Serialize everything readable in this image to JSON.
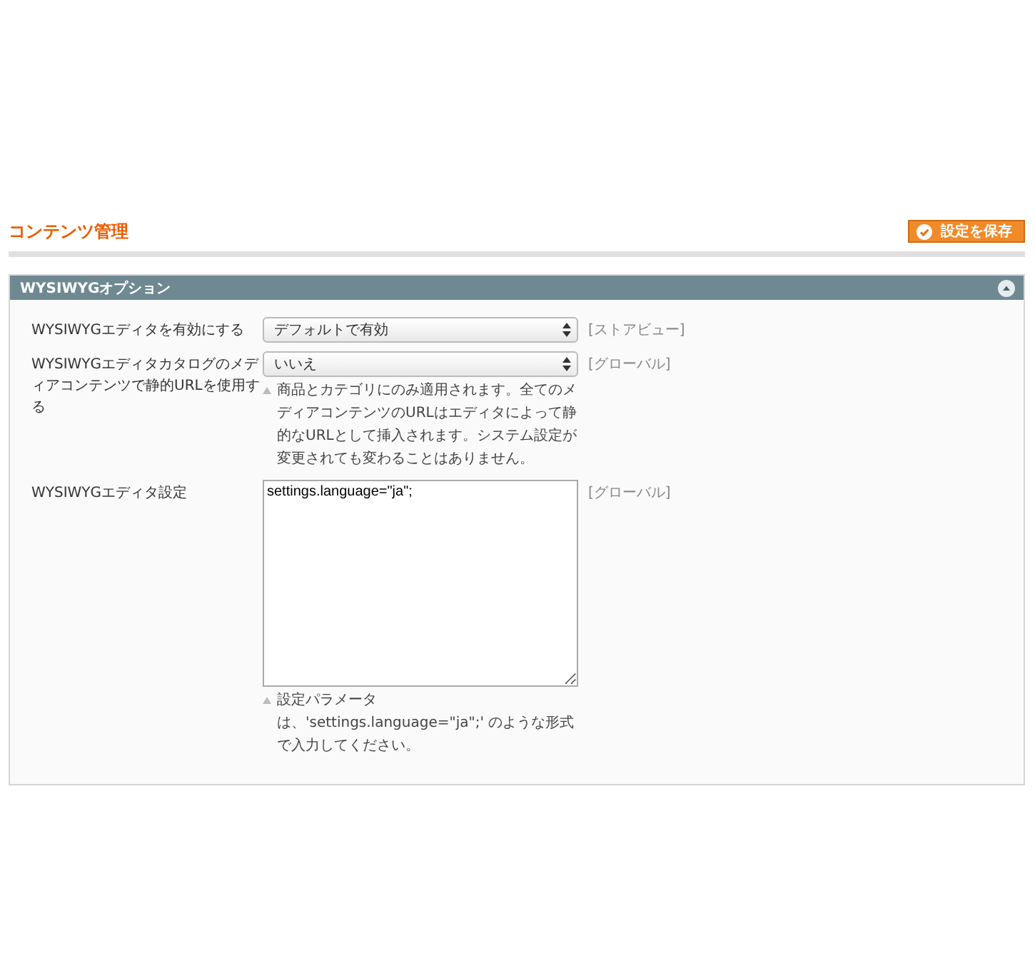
{
  "page_title": "コンテンツ管理",
  "save_button": "設定を保存",
  "section": {
    "title": "WYSIWYGオプション",
    "expanded": true,
    "fields": [
      {
        "kind": "select",
        "label": "WYSIWYGエディタを有効にする",
        "value": "デフォルトで有効",
        "scope": "[ストアビュー]"
      },
      {
        "kind": "select",
        "label": "WYSIWYGエディタカタログのメディアコンテンツで静的URLを使用する",
        "value": "いいえ",
        "scope": "[グローバル]",
        "hint": "商品とカテゴリにのみ適用されます。全てのメディアコンテンツのURLはエディタによって静的なURLとして挿入されます。システム設定が変更されても変わることはありません。"
      },
      {
        "kind": "textarea",
        "label": "WYSIWYGエディタ設定",
        "value": "settings.language=\"ja\";",
        "scope": "[グローバル]",
        "hint": "設定パラメータは、'settings.language=\"ja\";' のような形式で入力してください。"
      }
    ]
  }
}
